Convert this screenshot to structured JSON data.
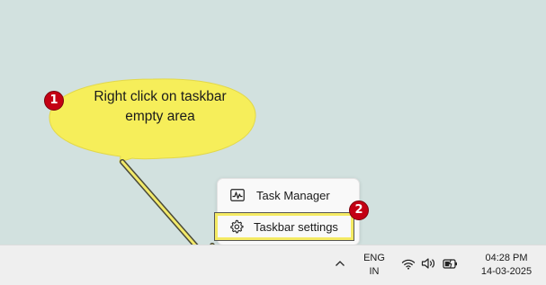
{
  "annotation": {
    "step1_number": "1",
    "step1_text_line1": "Right click on taskbar",
    "step1_text_line2": "empty area",
    "step2_number": "2",
    "bubble_color": "#f6ee5a",
    "badge_color": "#c40014",
    "highlight_color": "#f4ea63"
  },
  "context_menu": {
    "items": [
      {
        "label": "Task Manager",
        "icon": "task-manager-icon"
      },
      {
        "label": "Taskbar settings",
        "icon": "gear-icon"
      }
    ]
  },
  "taskbar": {
    "overflow_icon": "chevron-up-icon",
    "language_line1": "ENG",
    "language_line2": "IN",
    "tray_icons": [
      "wifi-icon",
      "speaker-icon",
      "battery-charging-icon"
    ],
    "time": "04:28 PM",
    "date": "14-03-2025"
  },
  "colors": {
    "desktop_background": "#d2e1df",
    "taskbar_background": "#efefef"
  }
}
